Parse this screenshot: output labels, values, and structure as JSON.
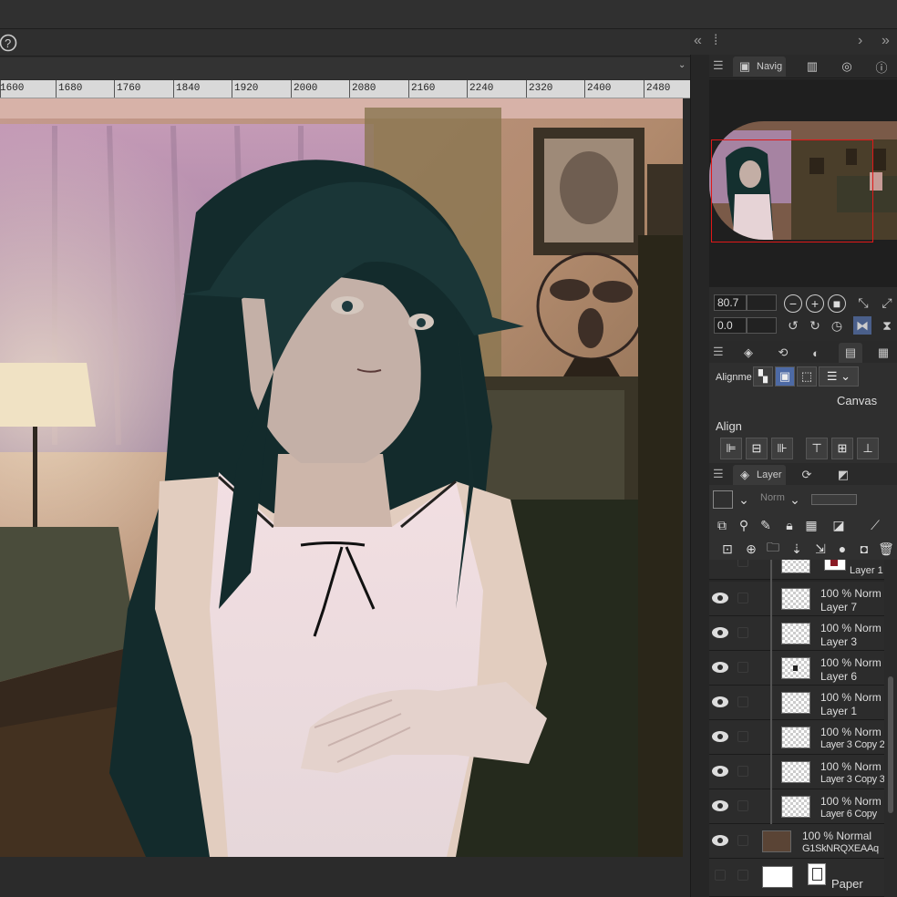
{
  "ruler": {
    "labels": [
      "1600",
      "1680",
      "1760",
      "1840",
      "1920",
      "2000",
      "2080",
      "2160",
      "2240",
      "2320",
      "2400",
      "2480"
    ]
  },
  "navigator": {
    "tab_label": "Navig"
  },
  "zoom": {
    "value": "80.7",
    "rotation": "0.0"
  },
  "alignment": {
    "label": "Alignme",
    "target": "Canvas",
    "align_label": "Align"
  },
  "layer_panel": {
    "tab_label": "Layer",
    "blend_mode": "Norm"
  },
  "layers": [
    {
      "mode": "",
      "name": "Layer 1"
    },
    {
      "mode": "100 % Norm",
      "name": "Layer 7"
    },
    {
      "mode": "100 % Norm",
      "name": "Layer 3"
    },
    {
      "mode": "100 % Norm",
      "name": "Layer 6"
    },
    {
      "mode": "100 % Norm",
      "name": "Layer 1"
    },
    {
      "mode": "100 % Norm",
      "name": "Layer 3 Copy 2"
    },
    {
      "mode": "100 % Norm",
      "name": "Layer 3 Copy 3"
    },
    {
      "mode": "100 % Norm",
      "name": "Layer 6 Copy"
    },
    {
      "mode": "100 % Normal",
      "name": "G1SkNRQXEAAq"
    },
    {
      "mode": "",
      "name": "Paper"
    }
  ],
  "colors": {
    "accent": "#4d6aa5",
    "nav_frame": "#e01818"
  }
}
